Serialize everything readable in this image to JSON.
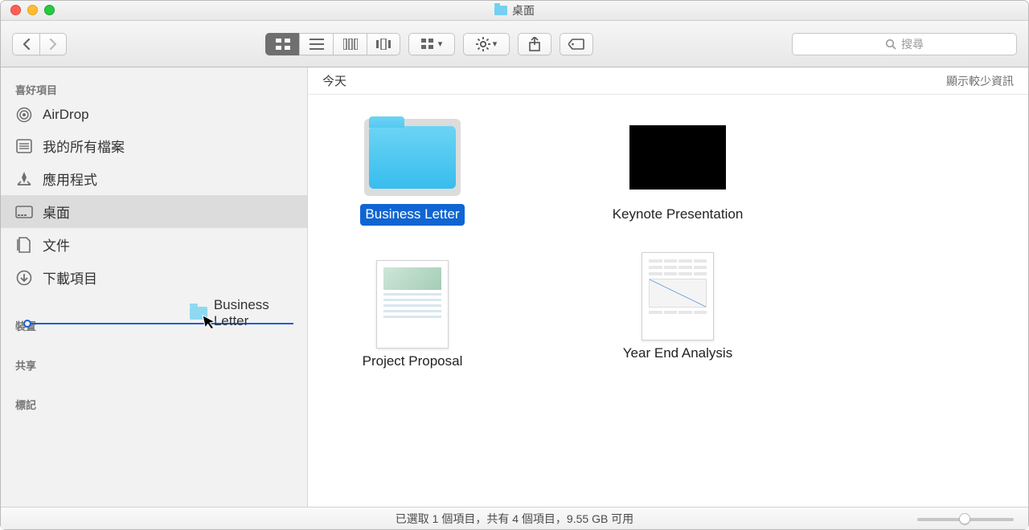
{
  "window": {
    "title": "桌面"
  },
  "toolbar": {
    "search_placeholder": "搜尋"
  },
  "sidebar": {
    "sections": {
      "favorites": "喜好項目",
      "devices": "裝置",
      "shared": "共享",
      "tags": "標記"
    },
    "items": [
      {
        "label": "AirDrop"
      },
      {
        "label": "我的所有檔案"
      },
      {
        "label": "應用程式"
      },
      {
        "label": "桌面"
      },
      {
        "label": "文件"
      },
      {
        "label": "下載項目"
      }
    ]
  },
  "content": {
    "group_label": "今天",
    "toggle_label": "顯示較少資訊",
    "items": [
      {
        "label": "Business Letter",
        "kind": "folder",
        "selected": true
      },
      {
        "label": "Keynote Presentation",
        "kind": "keynote",
        "selected": false
      },
      {
        "label": "Project Proposal",
        "kind": "doc",
        "selected": false
      },
      {
        "label": "Year End Analysis",
        "kind": "doc2",
        "selected": false
      }
    ]
  },
  "drag": {
    "ghost_label": "Business Letter"
  },
  "statusbar": {
    "text": "已選取 1 個項目，共有 4 個項目，9.55 GB 可用"
  }
}
